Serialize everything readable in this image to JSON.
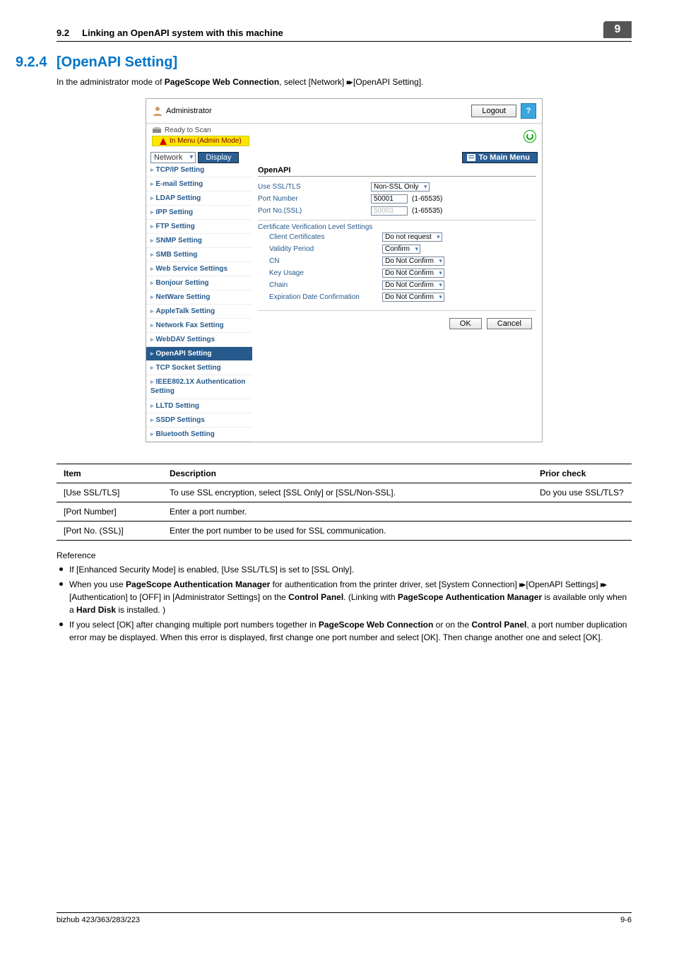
{
  "header": {
    "section_no": "9.2",
    "section_title": "Linking an OpenAPI system with this machine",
    "chapter_no": "9"
  },
  "title": {
    "number": "9.2.4",
    "text": "[OpenAPI Setting]"
  },
  "intro": {
    "pre": "In the administrator mode of ",
    "bold1": "PageScope Web Connection",
    "mid": ", select [Network] ",
    "arrow": "▸▸",
    "post": " [OpenAPI Setting]."
  },
  "mock": {
    "admin_label": "Administrator",
    "logout": "Logout",
    "help": "?",
    "ready": "Ready to Scan",
    "mode_tag": "In Menu (Admin Mode)",
    "network_select": "Network",
    "display_btn": "Display",
    "main_menu": "To Main Menu",
    "sidebar": [
      "TCP/IP Setting",
      "E-mail Setting",
      "LDAP Setting",
      "IPP Setting",
      "FTP Setting",
      "SNMP Setting",
      "SMB Setting",
      "Web Service Settings",
      "Bonjour Setting",
      "NetWare Setting",
      "AppleTalk Setting",
      "Network Fax Setting",
      "WebDAV Settings",
      "OpenAPI Setting",
      "TCP Socket Setting",
      "IEEE802.1X Authentication Setting",
      "LLTD Setting",
      "SSDP Settings",
      "Bluetooth Setting"
    ],
    "active_index": 13,
    "panel": {
      "heading": "OpenAPI",
      "rows": {
        "use_ssl": {
          "label": "Use SSL/TLS",
          "value": "Non-SSL Only"
        },
        "port_number": {
          "label": "Port Number",
          "value": "50001",
          "range": "(1-65535)"
        },
        "port_no_ssl": {
          "label": "Port No.(SSL)",
          "value": "50003",
          "range": "(1-65535)"
        },
        "cert_heading": "Certificate Verification Level Settings",
        "client_cert": {
          "label": "Client Certificates",
          "value": "Do not request"
        },
        "validity": {
          "label": "Validity Period",
          "value": "Confirm"
        },
        "cn": {
          "label": "CN",
          "value": "Do Not Confirm"
        },
        "key_usage": {
          "label": "Key Usage",
          "value": "Do Not Confirm"
        },
        "chain": {
          "label": "Chain",
          "value": "Do Not Confirm"
        },
        "expire": {
          "label": "Expiration Date Confirmation",
          "value": "Do Not Confirm"
        }
      },
      "ok": "OK",
      "cancel": "Cancel"
    }
  },
  "table": {
    "headers": {
      "item": "Item",
      "desc": "Description",
      "prior": "Prior check"
    },
    "rows": [
      {
        "item": "[Use SSL/TLS]",
        "desc": "To use SSL encryption, select [SSL Only] or [SSL/Non-SSL].",
        "prior": "Do you use SSL/TLS?"
      },
      {
        "item": "[Port Number]",
        "desc": "Enter a port number.",
        "prior": ""
      },
      {
        "item": "[Port No. (SSL)]",
        "desc": "Enter the port number to be used for SSL communication.",
        "prior": ""
      }
    ]
  },
  "reference": {
    "heading": "Reference",
    "b1": "If [Enhanced Security Mode] is enabled, [Use SSL/TLS] is set to [SSL Only].",
    "b2": {
      "p1": "When you use ",
      "bold_pam": "PageScope Authentication Manager",
      "p2": " for authentication from the printer driver, set [System Connection] ",
      "arrow1": "▸▸",
      "p3": " [OpenAPI Settings] ",
      "arrow2": "▸▸",
      "p4": " [Authentication] to [OFF] in [Administrator Settings] on the ",
      "bold_cp": "Control Panel",
      "p5": ". (Linking with ",
      "bold_pam2": "PageScope Authentication Manager",
      "p6": " is available only when a ",
      "bold_hd": "Hard Disk",
      "p7": " is installed. )"
    },
    "b3": {
      "p1": "If you select [OK] after changing multiple port numbers together in ",
      "bold_pwc": "PageScope Web Connection",
      "p2": " or on the ",
      "bold_cp": "Control Panel",
      "p3": ", a port number duplication error may be displayed. When this error is displayed, first change one port number and select [OK]. Then change another one and select [OK]."
    }
  },
  "footer": {
    "left": "bizhub 423/363/283/223",
    "right": "9-6"
  }
}
